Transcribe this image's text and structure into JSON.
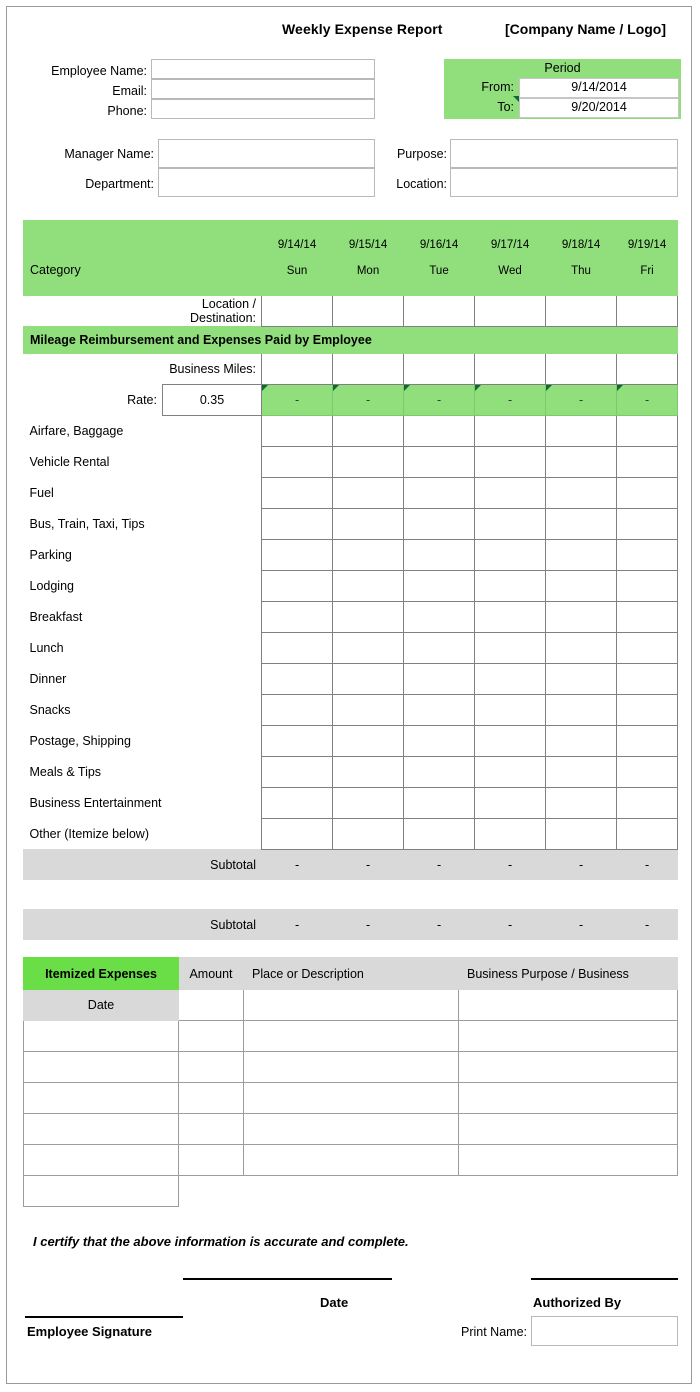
{
  "document": {
    "title": "Weekly Expense Report",
    "company_logo": "[Company Name / Logo]"
  },
  "employee_info": {
    "employee_name_label": "Employee Name:",
    "email_label": "Email:",
    "phone_label": "Phone:",
    "manager_name_label": "Manager Name:",
    "department_label": "Department:",
    "purpose_label": "Purpose:",
    "location_label": "Location:",
    "employee_name_value": "",
    "email_value": "",
    "phone_value": "",
    "manager_name_value": "",
    "department_value": "",
    "purpose_value": "",
    "location_value": ""
  },
  "period": {
    "title": "Period",
    "from_label": "From:",
    "to_label": "To:",
    "from_value": "9/14/2014",
    "to_value": "9/20/2014"
  },
  "expense_table": {
    "category_header": "Category",
    "days": [
      {
        "date": "9/14/14",
        "day": "Sun"
      },
      {
        "date": "9/15/14",
        "day": "Mon"
      },
      {
        "date": "9/16/14",
        "day": "Tue"
      },
      {
        "date": "9/17/14",
        "day": "Wed"
      },
      {
        "date": "9/18/14",
        "day": "Thu"
      },
      {
        "date": "9/19/14",
        "day": "Fri"
      }
    ],
    "location_destination_label": "Location / Destination:",
    "mileage_section_title": "Mileage Reimbursement and Expenses Paid by Employee",
    "business_miles_label": "Business Miles:",
    "rate_label": "Rate:",
    "rate_value": "0.35",
    "mileage_amounts": [
      "-",
      "-",
      "-",
      "-",
      "-",
      "-"
    ],
    "categories": [
      "Airfare, Baggage",
      "Vehicle Rental",
      "Fuel",
      "Bus, Train, Taxi, Tips",
      "Parking",
      "Lodging",
      "Breakfast",
      "Lunch",
      "Dinner",
      "Snacks",
      "Postage, Shipping",
      "Meals & Tips",
      "Business Entertainment",
      "Other (Itemize below)"
    ],
    "subtotal_label": "Subtotal",
    "subtotal_1": [
      "-",
      "-",
      "-",
      "-",
      "-",
      "-"
    ],
    "subtotal_2": [
      "-",
      "-",
      "-",
      "-",
      "-",
      "-"
    ]
  },
  "itemized": {
    "header_title": "Itemized Expenses",
    "col_amount": "Amount",
    "col_place": "Place or Description",
    "col_purpose": "Business Purpose / Business",
    "date_label": "Date"
  },
  "signature": {
    "certify_text": "I certify that the above information is accurate and complete.",
    "employee_signature_label": "Employee Signature",
    "date_label": "Date",
    "authorized_by_label": "Authorized By",
    "print_name_label": "Print Name:",
    "print_name_value": ""
  },
  "colors": {
    "header_green": "#90df7c",
    "bright_green": "#6ade47",
    "subtotal_gray": "#d9d9d9",
    "grid_line": "#808080"
  }
}
